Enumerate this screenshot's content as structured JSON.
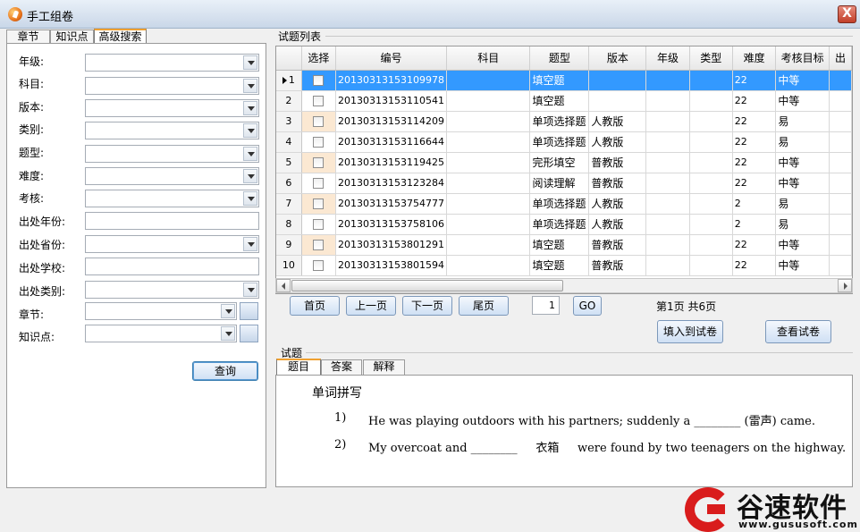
{
  "window": {
    "title": "手工组卷",
    "close_label": "X"
  },
  "left_tabs": [
    "章节",
    "知识点",
    "高级搜索"
  ],
  "filters": [
    {
      "label": "年级:",
      "kind": "combo",
      "value": ""
    },
    {
      "label": "科目:",
      "kind": "combo",
      "value": ""
    },
    {
      "label": "版本:",
      "kind": "combo",
      "value": ""
    },
    {
      "label": "类别:",
      "kind": "combo",
      "value": ""
    },
    {
      "label": "题型:",
      "kind": "combo",
      "value": ""
    },
    {
      "label": "难度:",
      "kind": "combo",
      "value": ""
    },
    {
      "label": "考核:",
      "kind": "combo",
      "value": ""
    },
    {
      "label": "出处年份:",
      "kind": "text",
      "value": ""
    },
    {
      "label": "出处省份:",
      "kind": "combo",
      "value": ""
    },
    {
      "label": "出处学校:",
      "kind": "text",
      "value": ""
    },
    {
      "label": "出处类别:",
      "kind": "combo",
      "value": ""
    },
    {
      "label": "章节:",
      "kind": "combo-browse",
      "value": ""
    },
    {
      "label": "知识点:",
      "kind": "combo-browse",
      "value": ""
    }
  ],
  "query_button": "查询",
  "list_section": {
    "title": "试题列表",
    "columns": [
      "选择",
      "编号",
      "科目",
      "题型",
      "版本",
      "年级",
      "类型",
      "难度",
      "考核目标",
      "出"
    ],
    "rows": [
      {
        "index": "1",
        "id": "20130313153109978",
        "subject": "",
        "qtype": "填空题",
        "version": "",
        "grade": "",
        "kind": "",
        "difficulty": "22",
        "goal": "中等",
        "selected": true
      },
      {
        "index": "2",
        "id": "20130313153110541",
        "subject": "",
        "qtype": "填空题",
        "version": "",
        "grade": "",
        "kind": "",
        "difficulty": "22",
        "goal": "中等",
        "selected": false
      },
      {
        "index": "3",
        "id": "20130313153114209",
        "subject": "",
        "qtype": "单项选择题",
        "version": "人教版",
        "grade": "",
        "kind": "",
        "difficulty": "22",
        "goal": "易",
        "selected": false
      },
      {
        "index": "4",
        "id": "20130313153116644",
        "subject": "",
        "qtype": "单项选择题",
        "version": "人教版",
        "grade": "",
        "kind": "",
        "difficulty": "22",
        "goal": "易",
        "selected": false
      },
      {
        "index": "5",
        "id": "20130313153119425",
        "subject": "",
        "qtype": "完形填空",
        "version": "普教版",
        "grade": "",
        "kind": "",
        "difficulty": "22",
        "goal": "中等",
        "selected": false
      },
      {
        "index": "6",
        "id": "20130313153123284",
        "subject": "",
        "qtype": "阅读理解",
        "version": "普教版",
        "grade": "",
        "kind": "",
        "difficulty": "22",
        "goal": "中等",
        "selected": false
      },
      {
        "index": "7",
        "id": "20130313153754777",
        "subject": "",
        "qtype": "单项选择题",
        "version": "人教版",
        "grade": "",
        "kind": "",
        "difficulty": "2",
        "goal": "易",
        "selected": false
      },
      {
        "index": "8",
        "id": "20130313153758106",
        "subject": "",
        "qtype": "单项选择题",
        "version": "人教版",
        "grade": "",
        "kind": "",
        "difficulty": "2",
        "goal": "易",
        "selected": false
      },
      {
        "index": "9",
        "id": "20130313153801291",
        "subject": "",
        "qtype": "填空题",
        "version": "普教版",
        "grade": "",
        "kind": "",
        "difficulty": "22",
        "goal": "中等",
        "selected": false
      },
      {
        "index": "10",
        "id": "20130313153801594",
        "subject": "",
        "qtype": "填空题",
        "version": "普教版",
        "grade": "",
        "kind": "",
        "difficulty": "22",
        "goal": "中等",
        "selected": false
      }
    ]
  },
  "pager": {
    "first": "首页",
    "prev": "上一页",
    "next": "下一页",
    "last": "尾页",
    "page_input": "1",
    "go": "GO",
    "info": "第1页 共6页"
  },
  "actions": {
    "add_to_paper": "填入到试卷",
    "view_paper": "查看试卷"
  },
  "question_section": {
    "title": "试题",
    "tabs": [
      "题目",
      "答案",
      "解释"
    ],
    "heading": "单词拼写",
    "lines": [
      {
        "num": "1)",
        "text": "He was playing outdoors with his partners; suddenly a ________ (雷声) came."
      },
      {
        "num": "2)",
        "text": "My overcoat and ________     衣箱     were found by two teenagers on the highway."
      }
    ]
  },
  "watermark": {
    "name": "谷速软件",
    "url": "www.gususoft.com"
  },
  "colors": {
    "selection": "#3399ff",
    "tab_accent": "#f0a030",
    "brand_red": "#d91c1c"
  }
}
